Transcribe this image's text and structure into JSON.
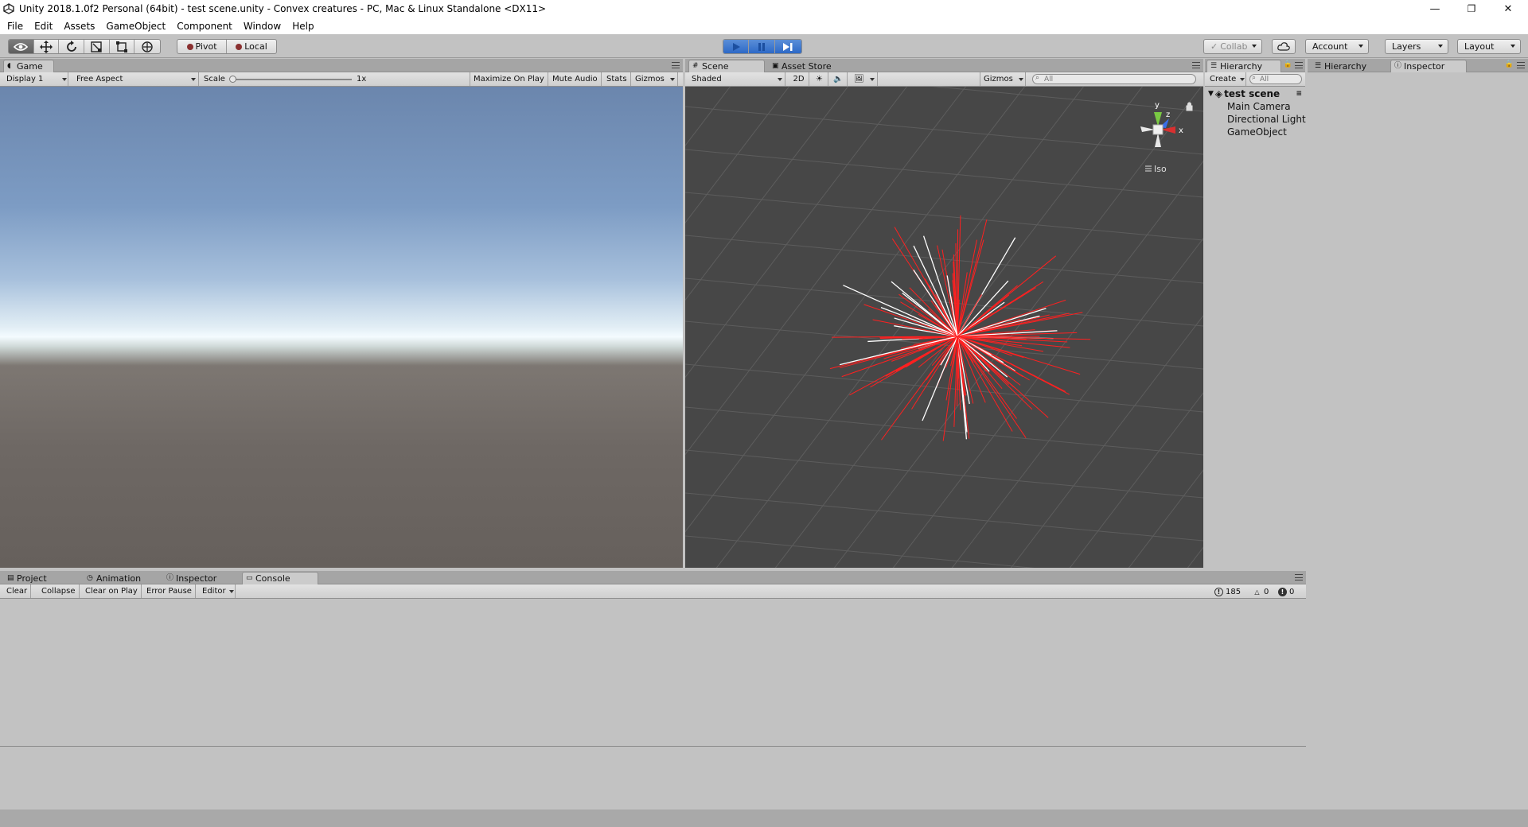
{
  "window": {
    "title": "Unity 2018.1.0f2 Personal (64bit) - test scene.unity - Convex creatures - PC, Mac & Linux Standalone <DX11>",
    "minimize": "—",
    "maximize": "❐",
    "close": "✕"
  },
  "menu": [
    "File",
    "Edit",
    "Assets",
    "GameObject",
    "Component",
    "Window",
    "Help"
  ],
  "toolbar": {
    "pivot": "Pivot",
    "local": "Local",
    "collab": "Collab",
    "account": "Account",
    "layers": "Layers",
    "layout": "Layout"
  },
  "game_panel": {
    "tab": "Game",
    "display": "Display 1",
    "aspect": "Free Aspect",
    "scale_label": "Scale",
    "scale_value": "1x",
    "maximize": "Maximize On Play",
    "mute": "Mute Audio",
    "stats": "Stats",
    "gizmos": "Gizmos"
  },
  "scene_panel": {
    "tabs": [
      "Scene",
      "Asset Store"
    ],
    "shading": "Shaded",
    "mode_2d": "2D",
    "gizmos": "Gizmos",
    "search_placeholder": "All",
    "gizmo_axes": {
      "y": "y",
      "z": "z",
      "x": "x"
    },
    "projection": "Iso"
  },
  "hierarchy_panel": {
    "tab": "Hierarchy",
    "create": "Create",
    "search_placeholder": "All",
    "scene_name": "test scene",
    "items": [
      "Main Camera",
      "Directional Light",
      "GameObject"
    ]
  },
  "right_panel": {
    "tabs": [
      "Hierarchy",
      "Inspector"
    ]
  },
  "bottom_panel": {
    "tabs": [
      "Project",
      "Animation",
      "Inspector",
      "Console"
    ],
    "buttons": [
      "Clear",
      "Collapse",
      "Clear on Play",
      "Error Pause",
      "Editor"
    ],
    "counts": {
      "info": "185",
      "warnings": "0",
      "errors": "0"
    }
  },
  "colors": {
    "editor_bg": "#c2c2c2",
    "scene_bg": "#474747",
    "play_blue": "#2d69c7",
    "ray_red": "#ff2020",
    "ray_white": "#ffffff"
  }
}
